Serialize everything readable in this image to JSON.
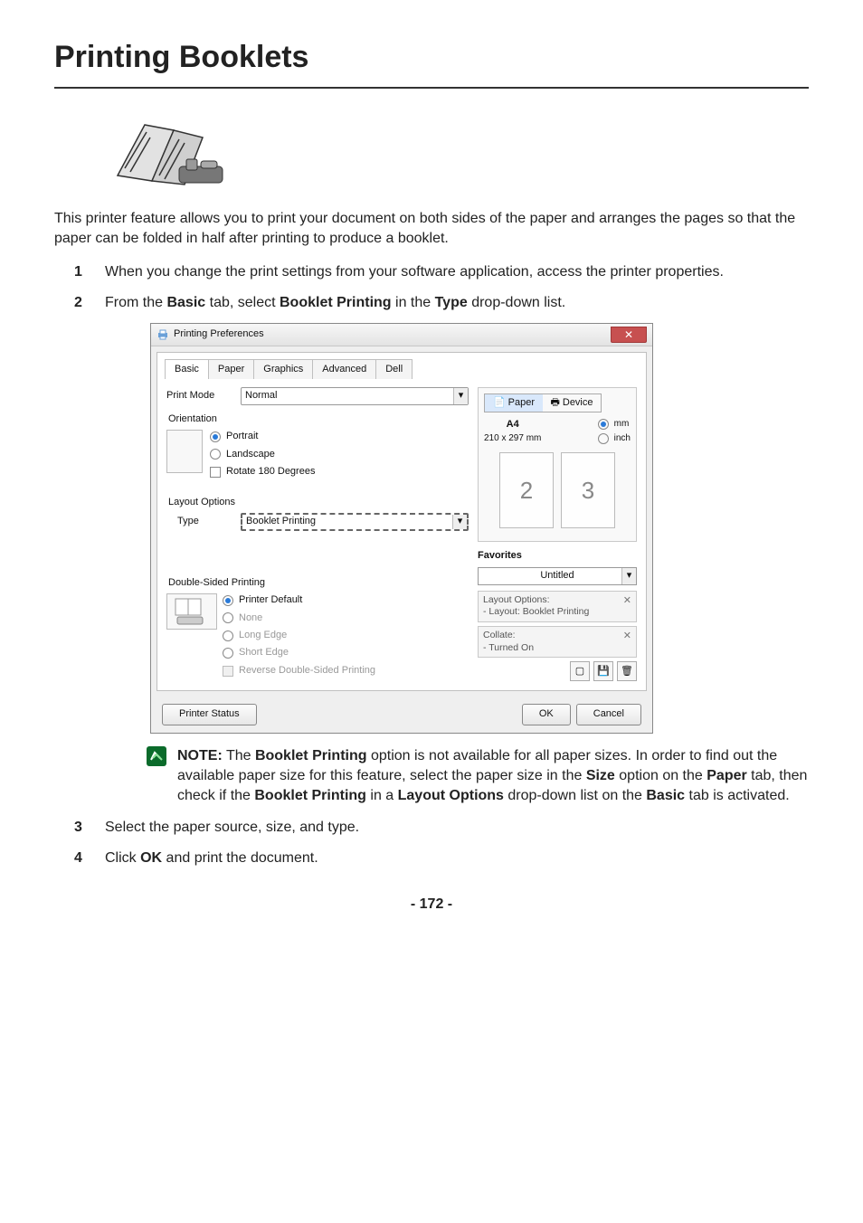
{
  "page": {
    "title": "Printing Booklets",
    "intro": "This printer feature allows you to print your document on both sides of the paper and arranges the pages so that the paper can be folded in half after printing to produce a booklet.",
    "page_number": "- 172 -"
  },
  "steps": {
    "s1_num": "1",
    "s1_text": "When you change the print settings from your software application, access the printer properties.",
    "s2_num": "2",
    "s2_pre": "From the ",
    "s2_b1": "Basic",
    "s2_mid": " tab, select ",
    "s2_b2": "Booklet Printing",
    "s2_mid2": " in the ",
    "s2_b3": "Type",
    "s2_end": " drop-down list.",
    "s3_num": "3",
    "s3_text": "Select the paper source, size, and type.",
    "s4_num": "4",
    "s4_pre": "Click ",
    "s4_b1": "OK",
    "s4_end": " and print the document."
  },
  "note": {
    "label": "NOTE:",
    "t1": " The ",
    "b1": "Booklet Printing",
    "t2": " option is not available for all paper sizes. In order to find out the available paper size for this feature, select the paper size in the ",
    "b2": "Size",
    "t3": " option on the ",
    "b3": "Paper",
    "t4": " tab, then check if the ",
    "b4": "Booklet Printing",
    "t5": " in a ",
    "b5": "Layout Options",
    "t6": " drop-down list on the ",
    "b6": "Basic",
    "t7": " tab is activated."
  },
  "dialog": {
    "title": "Printing Preferences",
    "tabs": [
      "Basic",
      "Paper",
      "Graphics",
      "Advanced",
      "Dell"
    ],
    "print_mode_label": "Print Mode",
    "print_mode_value": "Normal",
    "orientation_label": "Orientation",
    "orientation_options": {
      "portrait": "Portrait",
      "landscape": "Landscape",
      "rotate": "Rotate 180 Degrees"
    },
    "layout_label": "Layout Options",
    "type_label": "Type",
    "type_value": "Booklet Printing",
    "duplex_label": "Double-Sided Printing",
    "duplex_options": {
      "printer_default": "Printer Default",
      "none": "None",
      "long_edge": "Long Edge",
      "short_edge": "Short Edge",
      "reverse": "Reverse Double-Sided Printing"
    },
    "right": {
      "paper_tab": "Paper",
      "device_tab": "Device",
      "paper_size_name": "A4",
      "paper_size_dim": "210 x 297 mm",
      "unit_mm": "mm",
      "unit_inch": "inch",
      "page2": "2",
      "page3": "3",
      "favorites_label": "Favorites",
      "favorites_value": "Untitled",
      "fav_item1_l1": "Layout Options:",
      "fav_item1_l2": "- Layout: Booklet Printing",
      "fav_item2_l1": "Collate:",
      "fav_item2_l2": "- Turned On"
    },
    "printer_status": "Printer Status",
    "ok": "OK",
    "cancel": "Cancel"
  }
}
